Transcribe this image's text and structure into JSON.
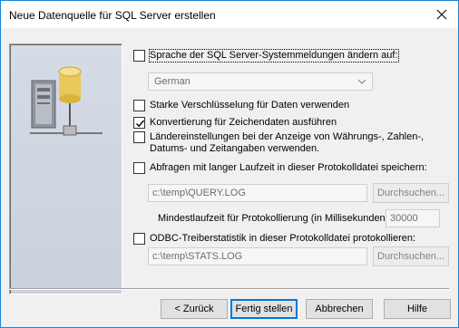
{
  "window": {
    "title": "Neue Datenquelle für SQL Server erstellen"
  },
  "icons": {
    "close": "close-icon",
    "server": "server-database-network-icon",
    "dropdown": "chevron-down-icon",
    "check": "checkmark-icon"
  },
  "options": {
    "language": {
      "label": "Sprache der SQL Server-Systemmeldungen ändern auf:",
      "checked": false,
      "select_value": "German"
    },
    "encryption": {
      "label": "Starke Verschlüsselung für Daten verwenden",
      "checked": false
    },
    "conversion": {
      "label": "Konvertierung für Zeichendaten ausführen",
      "checked": true
    },
    "regional": {
      "label": "Ländereinstellungen bei der Anzeige von Währungs-, Zahlen-, Datums- und Zeitangaben verwenden.",
      "checked": false
    },
    "long_queries": {
      "label": "Abfragen mit langer Laufzeit in dieser Protokolldatei speichern:",
      "checked": false,
      "file_path": "c:\\temp\\QUERY.LOG",
      "browse_label": "Durchsuchen...",
      "min_time_label": "Mindestlaufzeit für Protokollierung (in Millisekunden):",
      "min_time_value": "30000"
    },
    "odbc_stats": {
      "label": "ODBC-Treiberstatistik in dieser Protokolldatei protokollieren:",
      "checked": false,
      "file_path": "c:\\temp\\STATS.LOG",
      "browse_label": "Durchsuchen..."
    }
  },
  "footer": {
    "back_label": "< Zurück",
    "finish_label": "Fertig stellen",
    "cancel_label": "Abbrechen",
    "help_label": "Hilfe"
  }
}
